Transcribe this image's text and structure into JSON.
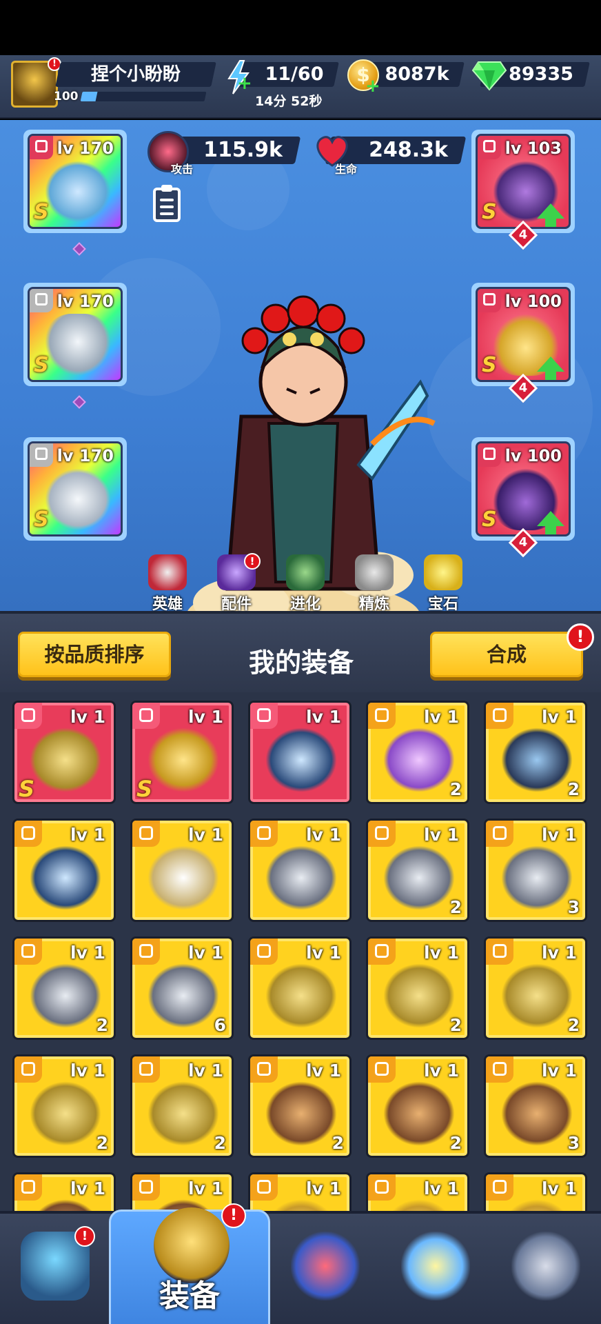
{
  "header": {
    "player_name": "捏个小盼盼",
    "player_level": "100",
    "xp_fraction": 0.12,
    "energy": "11/60",
    "energy_timer": "14分 52秒",
    "coins": "8087k",
    "gems": "89335",
    "avatar_alert": "!"
  },
  "hero_panel": {
    "attack_value": "115.9k",
    "attack_label": "攻击",
    "hp_value": "248.3k",
    "hp_label": "生命",
    "left_slots": [
      {
        "level": "lv 170",
        "grade": "S",
        "icon": "dagger-icon"
      },
      {
        "level": "lv 170",
        "grade": "S",
        "icon": "helmet-icon"
      },
      {
        "level": "lv 170",
        "grade": "S",
        "icon": "gauntlet-icon"
      }
    ],
    "right_slots": [
      {
        "level": "lv 103",
        "grade": "S",
        "stars": "4",
        "icon": "chest-armor-icon"
      },
      {
        "level": "lv 100",
        "grade": "S",
        "stars": "4",
        "icon": "ring-icon"
      },
      {
        "level": "lv 100",
        "grade": "S",
        "stars": "4",
        "icon": "boots-icon"
      }
    ],
    "tabs": [
      {
        "label": "英雄",
        "icon": "hero-icon"
      },
      {
        "label": "配件",
        "icon": "parts-icon",
        "alert": "!"
      },
      {
        "label": "进化",
        "icon": "evolve-icon"
      },
      {
        "label": "精炼",
        "icon": "refine-icon"
      },
      {
        "label": "宝石",
        "icon": "gem-icon"
      }
    ]
  },
  "equip_header": {
    "sort_button": "按品质排序",
    "title": "我的装备",
    "merge_button": "合成",
    "merge_alert": "!"
  },
  "items": [
    {
      "level": "lv 1",
      "grade": "S",
      "count": "",
      "color": "pink",
      "icon": "gauntlet-icon"
    },
    {
      "level": "lv 1",
      "grade": "S",
      "count": "",
      "color": "pink",
      "icon": "axe-icon"
    },
    {
      "level": "lv 1",
      "grade": "",
      "count": "",
      "color": "pink",
      "icon": "cannon-icon"
    },
    {
      "level": "lv 1",
      "grade": "",
      "count": "2",
      "color": "yellow",
      "icon": "blaster-icon"
    },
    {
      "level": "lv 1",
      "grade": "",
      "count": "2",
      "color": "yellow",
      "icon": "bat-icon"
    },
    {
      "level": "lv 1",
      "grade": "",
      "count": "",
      "color": "yellow",
      "icon": "cannon-icon"
    },
    {
      "level": "lv 1",
      "grade": "",
      "count": "",
      "color": "yellow",
      "icon": "sword-icon"
    },
    {
      "level": "lv 1",
      "grade": "",
      "count": "",
      "color": "yellow",
      "icon": "helmet-icon"
    },
    {
      "level": "lv 1",
      "grade": "",
      "count": "2",
      "color": "yellow",
      "icon": "helmet-icon"
    },
    {
      "level": "lv 1",
      "grade": "",
      "count": "3",
      "color": "yellow",
      "icon": "helmet-icon"
    },
    {
      "level": "lv 1",
      "grade": "",
      "count": "2",
      "color": "yellow",
      "icon": "helmet-icon"
    },
    {
      "level": "lv 1",
      "grade": "",
      "count": "6",
      "color": "yellow",
      "icon": "helmet-icon"
    },
    {
      "level": "lv 1",
      "grade": "",
      "count": "",
      "color": "yellow",
      "icon": "gauntlet-icon"
    },
    {
      "level": "lv 1",
      "grade": "",
      "count": "2",
      "color": "yellow",
      "icon": "gauntlet-icon"
    },
    {
      "level": "lv 1",
      "grade": "",
      "count": "2",
      "color": "yellow",
      "icon": "gauntlet-icon"
    },
    {
      "level": "lv 1",
      "grade": "",
      "count": "2",
      "color": "yellow",
      "icon": "gauntlet-icon"
    },
    {
      "level": "lv 1",
      "grade": "",
      "count": "2",
      "color": "yellow",
      "icon": "gauntlet-icon"
    },
    {
      "level": "lv 1",
      "grade": "",
      "count": "2",
      "color": "yellow",
      "icon": "chest-armor-icon"
    },
    {
      "level": "lv 1",
      "grade": "",
      "count": "2",
      "color": "yellow",
      "icon": "chest-armor-icon"
    },
    {
      "level": "lv 1",
      "grade": "",
      "count": "3",
      "color": "yellow",
      "icon": "chest-armor-icon"
    },
    {
      "level": "lv 1",
      "grade": "",
      "count": "",
      "color": "yellow",
      "icon": "chest-armor-icon"
    },
    {
      "level": "lv 1",
      "grade": "",
      "count": "",
      "color": "yellow",
      "icon": "chest-armor-icon"
    },
    {
      "level": "lv 1",
      "grade": "",
      "count": "",
      "color": "yellow",
      "icon": "ring-icon"
    },
    {
      "level": "lv 1",
      "grade": "",
      "count": "",
      "color": "yellow",
      "icon": "ring-icon"
    },
    {
      "level": "lv 1",
      "grade": "",
      "count": "",
      "color": "yellow",
      "icon": "ring-icon"
    }
  ],
  "bottom_nav": [
    {
      "label": "",
      "icon": "treasure-chest-icon",
      "alert": "!"
    },
    {
      "label": "装备",
      "icon": "equipment-helmet-icon",
      "alert": "!",
      "active": true
    },
    {
      "label": "",
      "icon": "battle-swords-icon"
    },
    {
      "label": "",
      "icon": "pet-robot-icon"
    },
    {
      "label": "",
      "icon": "ranking-crest-icon"
    }
  ],
  "colors": {
    "accent_yellow": "#ffd21f",
    "pink_card": "#e83c5a",
    "panel_blue": "#3e7fd4",
    "alert_red": "#e0141c",
    "energy_green": "#3cd24b"
  }
}
